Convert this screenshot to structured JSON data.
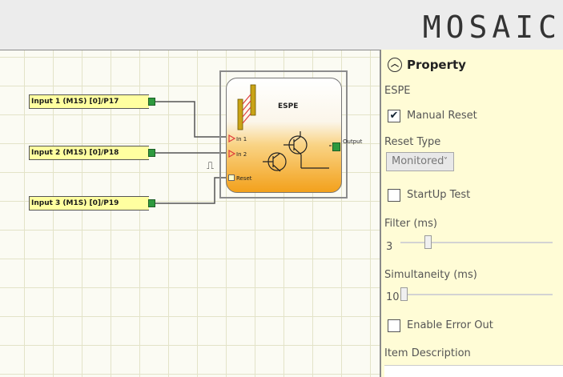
{
  "header": {
    "logo_text": "MOSAIC"
  },
  "canvas": {
    "inputs": [
      {
        "label": "Input 1 (M1S) [0]/P17"
      },
      {
        "label": "Input 2 (M1S) [0]/P18"
      },
      {
        "label": "Input 3 (M1S) [0]/P19"
      }
    ],
    "espe_block": {
      "title": "ESPE",
      "pins": {
        "in1": "In 1",
        "in2": "In 2",
        "reset": "Reset"
      },
      "output": "Output"
    },
    "pulse_symbol": "⎍"
  },
  "property_panel": {
    "title": "Property",
    "collapse_icon": "chevron-up",
    "block_name": "ESPE",
    "manual_reset": {
      "label": "Manual Reset",
      "checked": true,
      "mark": "✔"
    },
    "reset_type": {
      "label": "Reset Type",
      "value": "Monitored",
      "chevron": "˅"
    },
    "startup_test": {
      "label": "StartUp Test",
      "checked": false
    },
    "filter": {
      "label": "Filter (ms)",
      "value": "3"
    },
    "simultaneity": {
      "label": "Simultaneity (ms)",
      "value": "10"
    },
    "enable_error_out": {
      "label": "Enable Error Out",
      "checked": false
    },
    "item_description": {
      "label": "Item Description",
      "value": ""
    }
  },
  "colors": {
    "panel_bg": "#fffcd6",
    "canvas_bg": "#fbfbf3",
    "port_green": "#2e9a3e",
    "block_orange": "#f3a11c",
    "input_yellow": "#ffffa0"
  }
}
